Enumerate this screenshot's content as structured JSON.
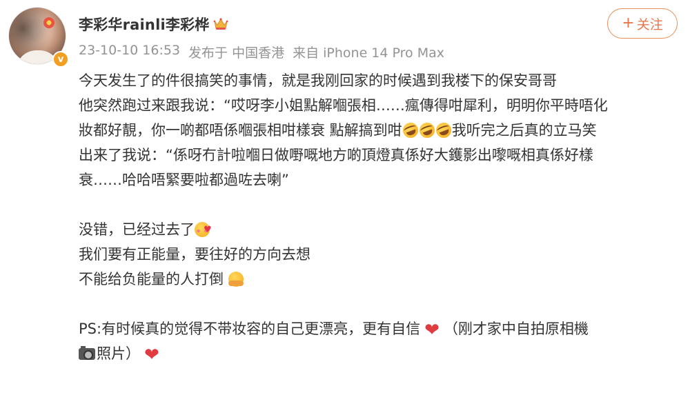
{
  "author": {
    "name": "李彩华rainli李彩桦",
    "badge_icon": "crown-icon",
    "verified_icon": "verified-badge-icon",
    "verified_color": "#f2a023"
  },
  "meta": {
    "time": "23-10-10 16:53",
    "location": "发布于 中国香港",
    "device": "来自 iPhone 14 Pro Max"
  },
  "follow": {
    "plus": "+",
    "label": "关注",
    "color": "#e8764a"
  },
  "post": {
    "line1": "今天发生了的件很搞笑的事情，就是我刚回家的时候遇到我楼下的保安哥哥",
    "line2": "他突然跑过来跟我说：“哎呀李小姐點解嗰張相……瘋傳得咁犀利，明明你平時唔化",
    "line3_a": "妝都好靚，你一啲都唔係嗰張相咁樣衰 點解搞到咁",
    "line3_b": "我听完之后真的立马笑",
    "line4": "出来了我说：“係呀冇計啦嗰日做嘢嘅地方啲頂燈真係好大鑊影出嚟嘅相真係好樣",
    "line5": "衰……哈哈唔緊要啦都過咗去喇”",
    "line6": "没错，已经过去了",
    "line7": "我们要有正能量，要往好的方向去想",
    "line8": "不能给负能量的人打倒",
    "line9_a": "PS:有时候真的觉得不带妆容的自己更漂亮，更有自信",
    "line9_b": "（刚才家中自拍原相機",
    "line10": "照片）"
  },
  "emojis": {
    "rofl": "rolling-on-floor-laughing-icon",
    "love": "smiling-face-with-hearts-icon",
    "hug": "hugging-face-icon",
    "heart": "red-heart-icon",
    "camera": "camera-icon"
  }
}
